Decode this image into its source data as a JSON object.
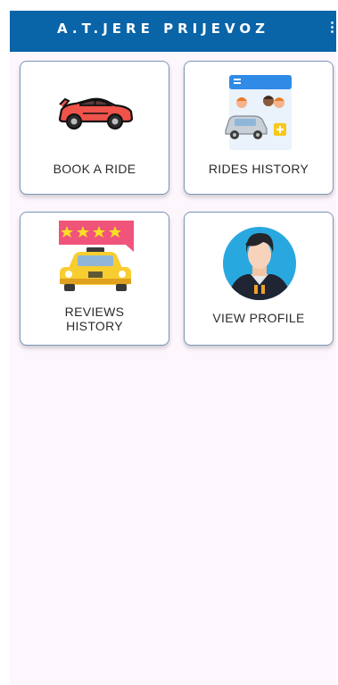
{
  "app_bar": {
    "title": "A.T.JERE PRIJEVOZ",
    "menu_icon": "more-vert-icon",
    "background": "#0964a8"
  },
  "menu": [
    {
      "id": "book-ride",
      "label": "BOOK A RIDE",
      "icon": "red-sports-car-icon"
    },
    {
      "id": "rides-history",
      "label": "RIDES HISTORY",
      "icon": "passengers-car-history-icon"
    },
    {
      "id": "reviews-history",
      "label": "REVIEWS\nHISTORY",
      "icon": "taxi-four-stars-icon"
    },
    {
      "id": "view-profile",
      "label": "VIEW PROFILE",
      "icon": "user-avatar-icon"
    }
  ]
}
